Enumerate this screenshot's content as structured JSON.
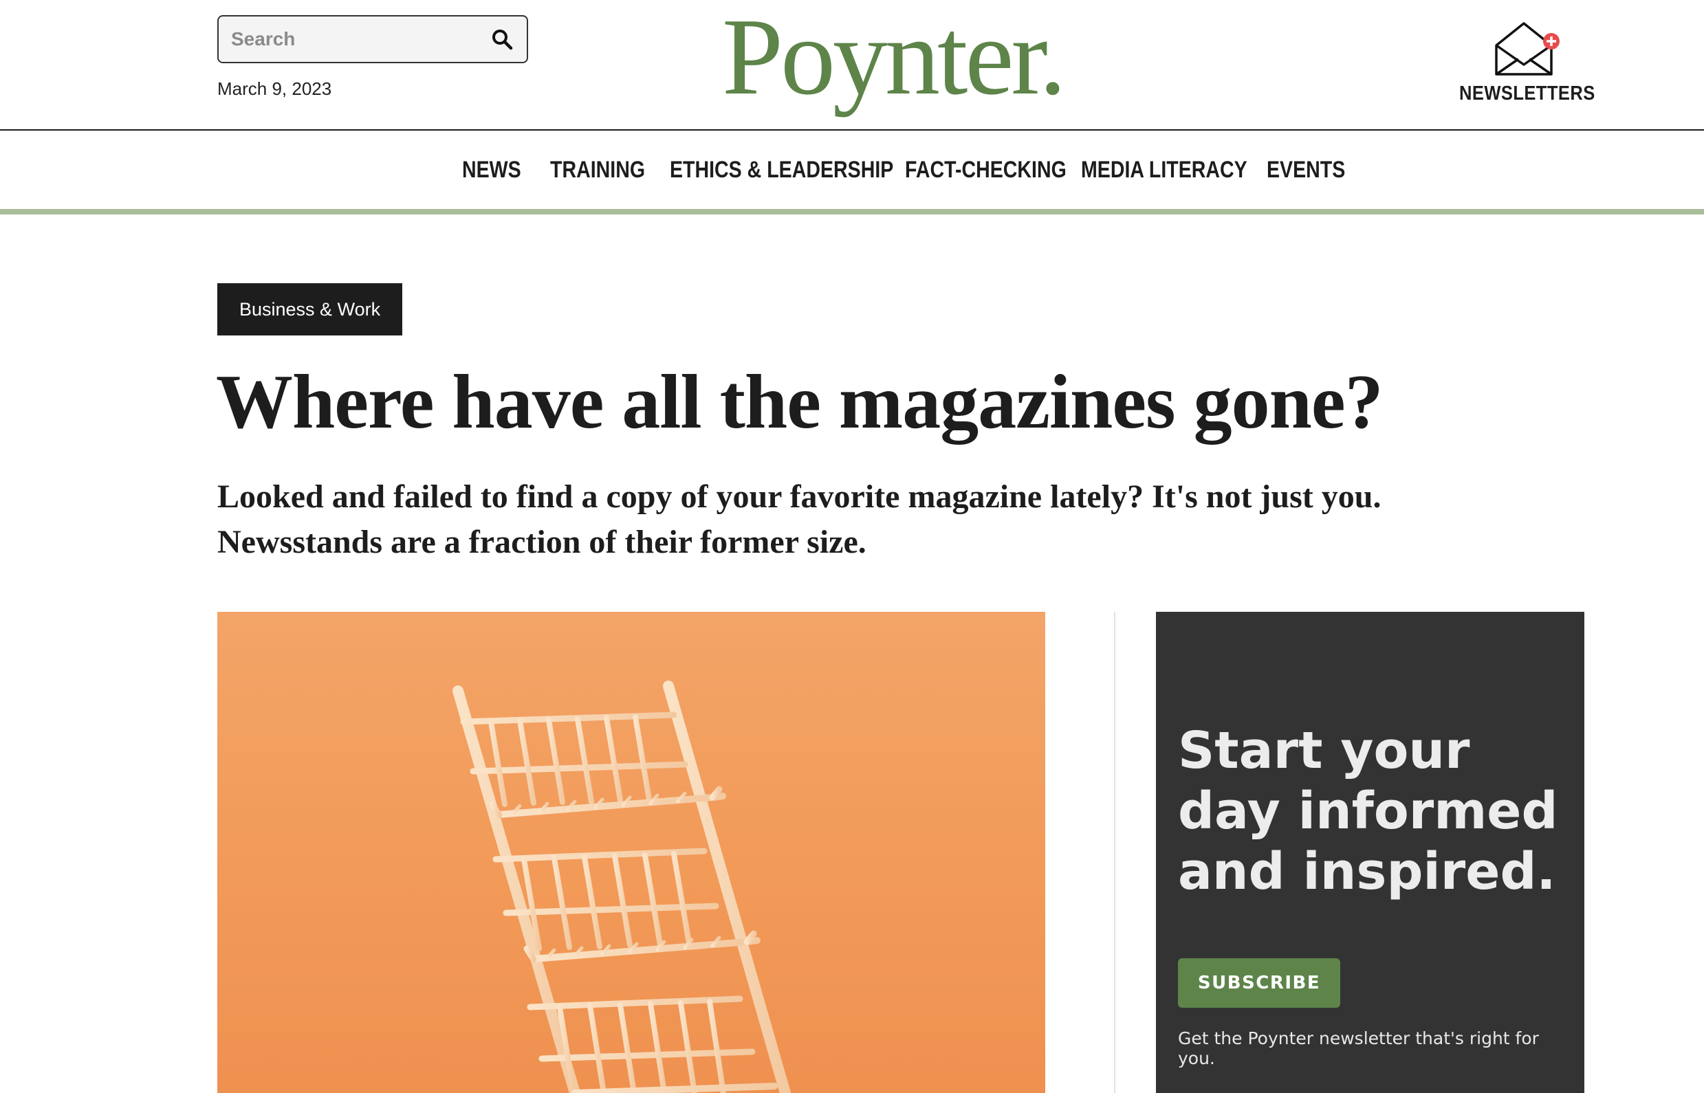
{
  "header": {
    "search_placeholder": "Search",
    "date": "March 9, 2023",
    "logo_text": "Poynter.",
    "newsletters_label": "NEWSLETTERS",
    "icons": {
      "search": "search-icon",
      "newsletters": "envelope-plus-icon"
    }
  },
  "nav": {
    "items": [
      {
        "label": "NEWS"
      },
      {
        "label": "TRAINING"
      },
      {
        "label": "ETHICS & LEADERSHIP"
      },
      {
        "label": "FACT-CHECKING"
      },
      {
        "label": "MEDIA LITERACY"
      },
      {
        "label": "EVENTS"
      }
    ]
  },
  "article": {
    "category": "Business & Work",
    "headline": "Where have all the magazines gone?",
    "dek": "Looked and failed to find a copy of your favorite magazine lately? It's not just you. Newsstands are a fraction of their former size."
  },
  "promo": {
    "title": "Start your day informed and inspired.",
    "button_label": "SUBSCRIBE",
    "subtext": "Get the Poynter newsletter that's right for you."
  },
  "colors": {
    "brand_green": "#5e844a",
    "nav_rule": "#a9bd9a",
    "dark": "#1d1d1d",
    "promo_bg": "#333333",
    "hero_orange": "#f29a58",
    "badge_red": "#e74c4c"
  }
}
